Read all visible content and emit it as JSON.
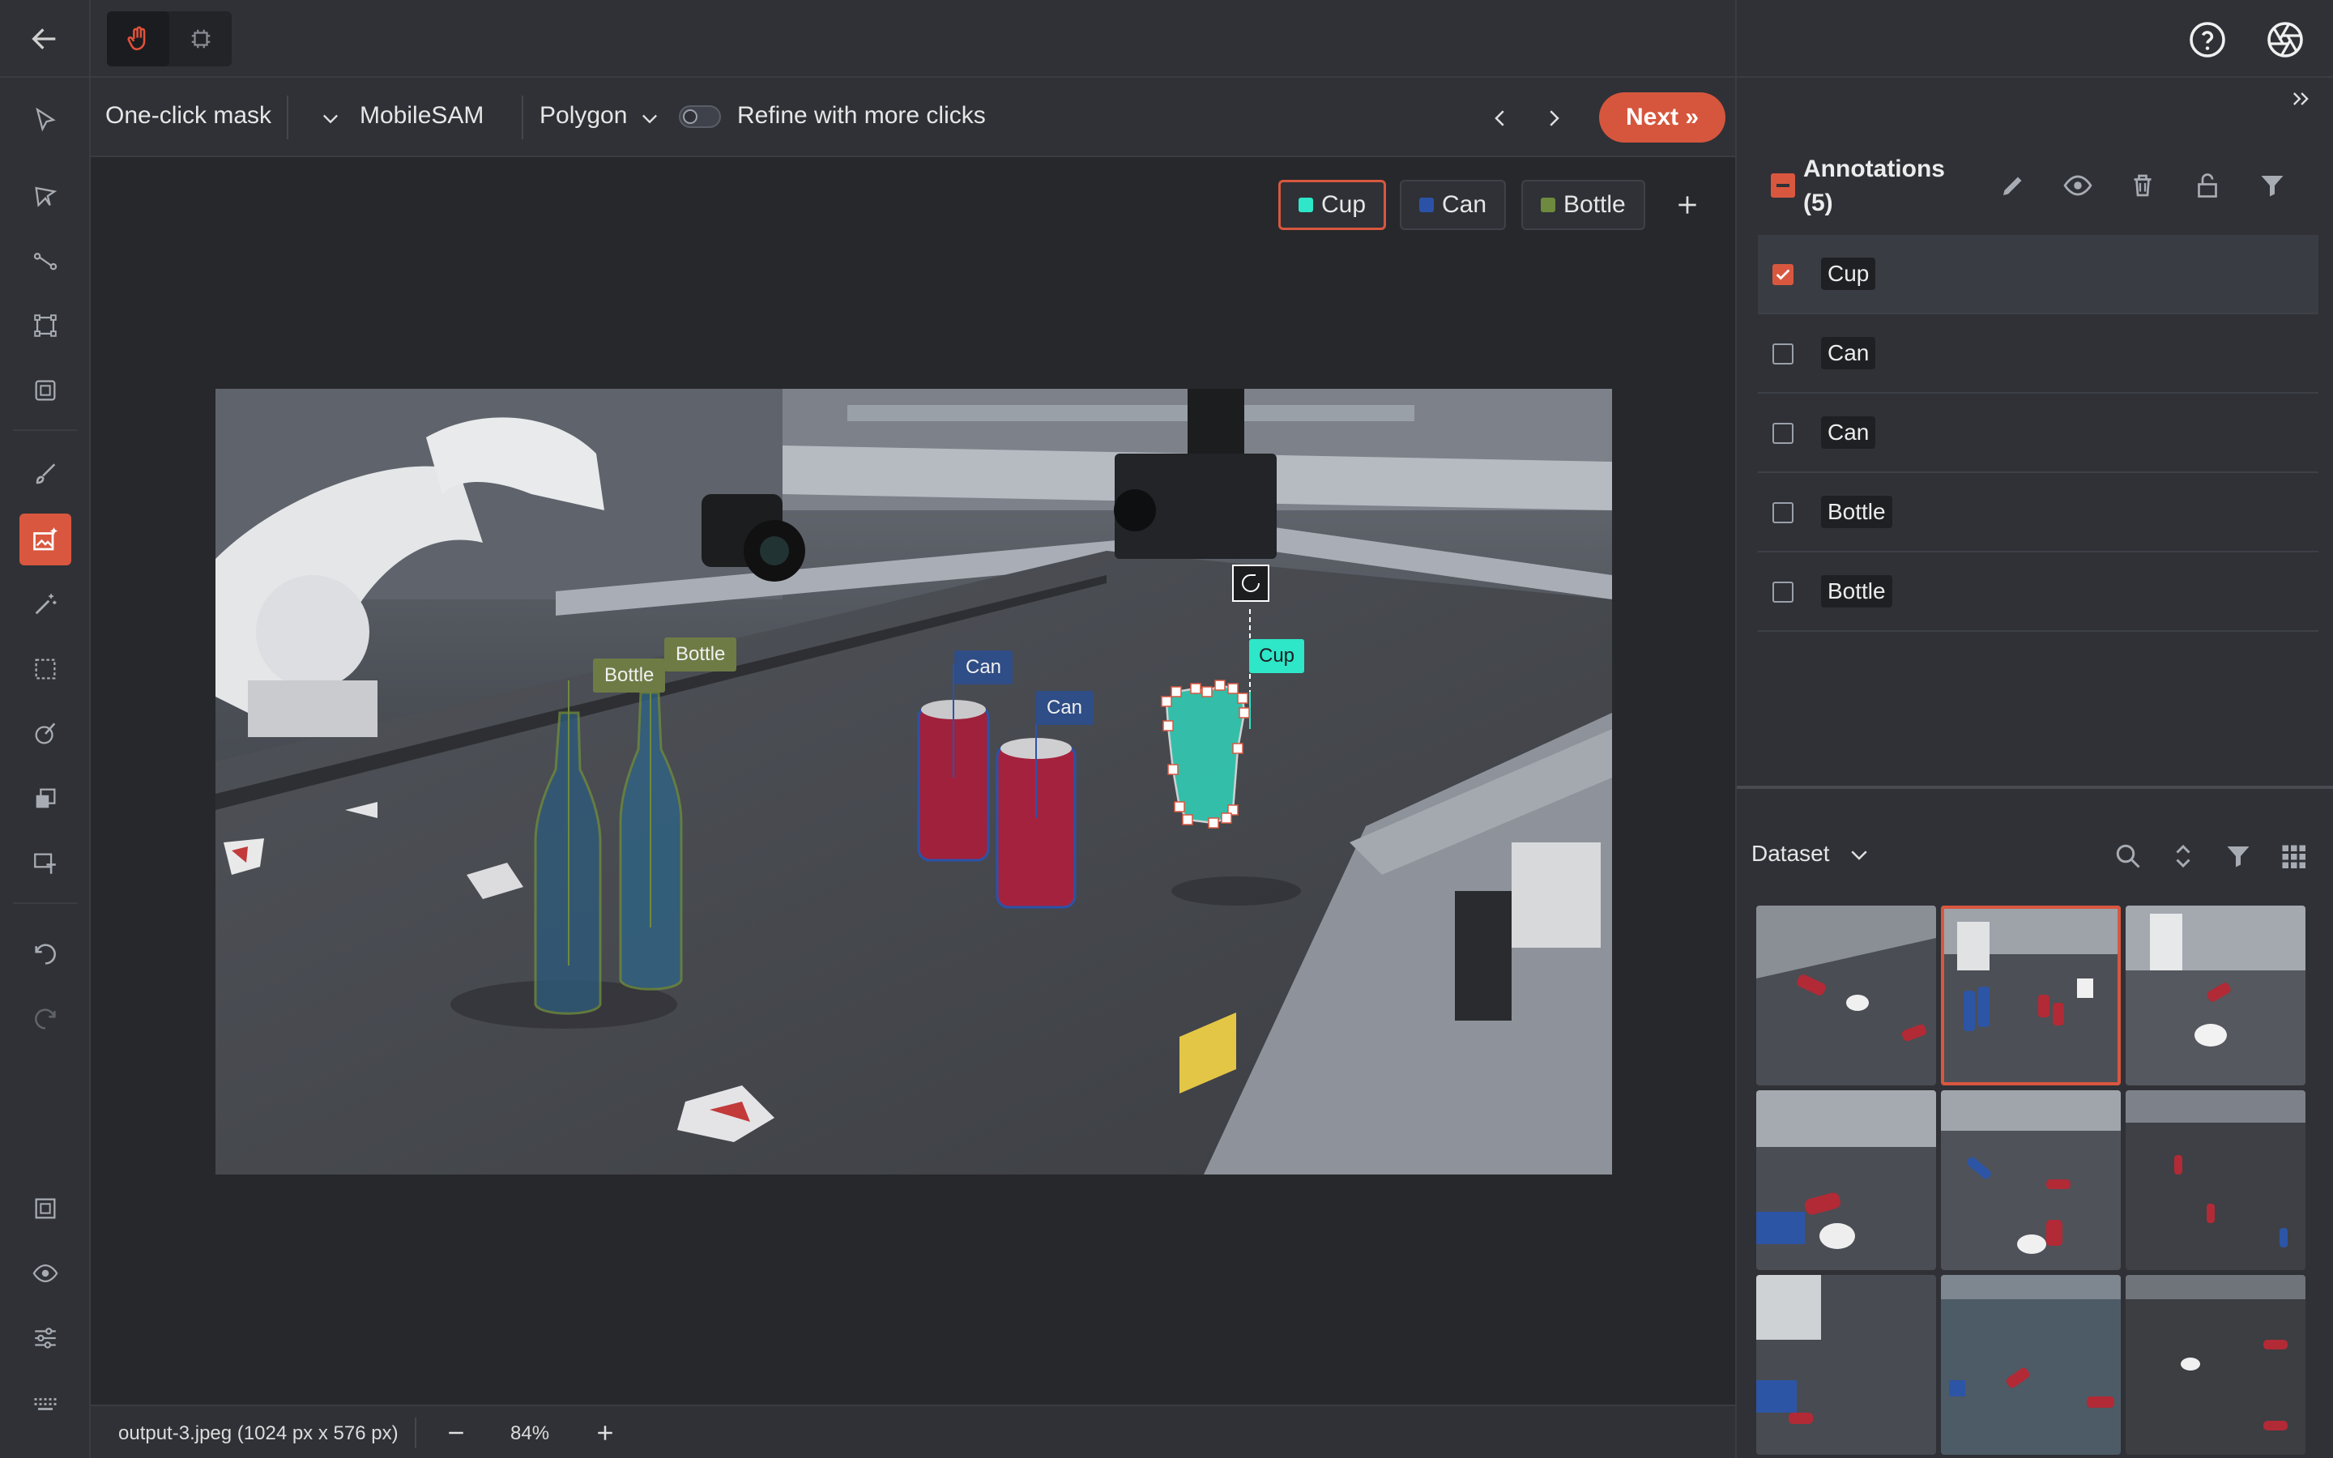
{
  "subbar": {
    "tool_name": "One-click mask",
    "model": "MobileSAM",
    "output_type": "Polygon",
    "refine_label": "Refine with more clicks",
    "refine_enabled": false,
    "next_label": "Next »"
  },
  "classes": [
    {
      "label": "Cup",
      "color": "#2ee6c8",
      "selected": true
    },
    {
      "label": "Can",
      "color": "#2c52a8",
      "selected": false
    },
    {
      "label": "Bottle",
      "color": "#6e8a3e",
      "selected": false
    }
  ],
  "image_labels": {
    "bottle_1": "Bottle",
    "bottle_2": "Bottle",
    "can_1": "Can",
    "can_2": "Can",
    "cup": "Cup"
  },
  "annotations": {
    "title": "Annotations",
    "count": "(5)",
    "items": [
      {
        "label": "Cup",
        "checked": true
      },
      {
        "label": "Can",
        "checked": false
      },
      {
        "label": "Can",
        "checked": false
      },
      {
        "label": "Bottle",
        "checked": false
      },
      {
        "label": "Bottle",
        "checked": false
      }
    ]
  },
  "dataset": {
    "title": "Dataset",
    "thumbnail_count": 9,
    "selected_thumbnail": 2
  },
  "status": {
    "filename": "output-3.jpeg (1024 px x 576 px)",
    "zoom": "84%"
  },
  "colors": {
    "accent": "#d9573f",
    "cup": "#2ee6c8",
    "can": "#2c52a8",
    "bottle": "#6e8a3e"
  }
}
